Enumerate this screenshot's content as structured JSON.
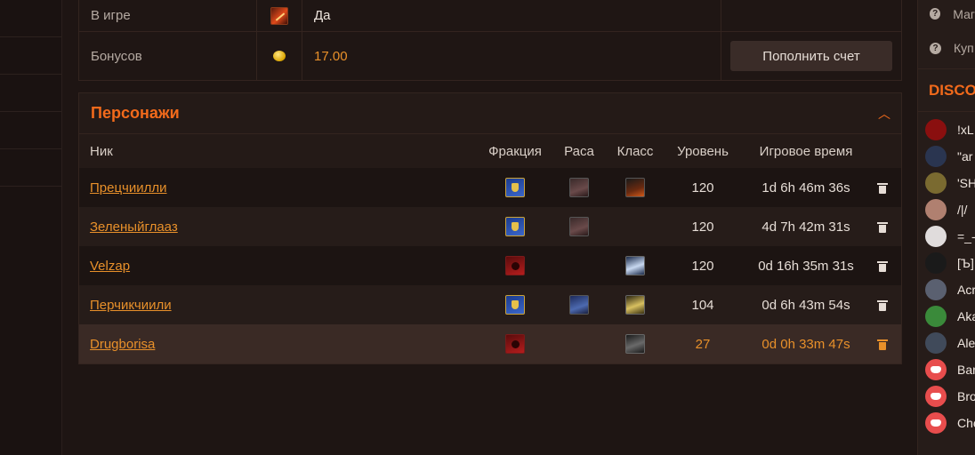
{
  "account_info": {
    "rows": [
      {
        "label": "В игре",
        "icon": "game-icon",
        "value": "Да"
      },
      {
        "label": "Бонусов",
        "icon": "coin-icon",
        "value": "17.00",
        "action": "Пополнить счет"
      }
    ]
  },
  "characters": {
    "title": "Персонажи",
    "columns": {
      "nick": "Ник",
      "faction": "Фракция",
      "race": "Раса",
      "class": "Класс",
      "level": "Уровень",
      "time": "Игровое время"
    },
    "rows": [
      {
        "nick": "Прецчиилли",
        "faction": "alliance",
        "race": "race-icon",
        "class": "class-rogue",
        "level": "120",
        "time": "1d 6h 46m 36s"
      },
      {
        "nick": "Зеленыйглааз",
        "faction": "alliance",
        "race": "race-icon",
        "class": "",
        "level": "120",
        "time": "4d 7h 42m 31s"
      },
      {
        "nick": "Velzap",
        "faction": "horde",
        "race": "",
        "class": "class-warrior",
        "level": "120",
        "time": "0d 16h 35m 31s"
      },
      {
        "nick": "Перчикчиили",
        "faction": "alliance",
        "race": "race-blue",
        "class": "class-paladin",
        "level": "104",
        "time": "0d 6h 43m 54s"
      },
      {
        "nick": "Drugborisa",
        "faction": "horde",
        "race": "",
        "class": "class-dk",
        "level": "27",
        "time": "0d 0h 33m 47s"
      }
    ]
  },
  "right_sidebar": {
    "links": [
      "Маг",
      "Куп"
    ],
    "discord_title": "DISCO",
    "members": [
      {
        "name": "!xL",
        "avatar": "#8a0f0f"
      },
      {
        "name": "\"ar",
        "avatar": "#2a3550"
      },
      {
        "name": "'SH",
        "avatar": "#7a6a30"
      },
      {
        "name": "/|/",
        "avatar": "#b08070"
      },
      {
        "name": "=_-",
        "avatar": "#e0dcdc"
      },
      {
        "name": "[Ъ]",
        "avatar": "#1a1a1a"
      },
      {
        "name": "Acr",
        "avatar": "#5a6070"
      },
      {
        "name": "Aka",
        "avatar": "#3a8a3a"
      },
      {
        "name": "Ale",
        "avatar": "#404a5a"
      },
      {
        "name": "Bar",
        "avatar": "discord"
      },
      {
        "name": "Bro",
        "avatar": "discord"
      },
      {
        "name": "Che",
        "avatar": "discord"
      }
    ]
  },
  "colors": {
    "accent": "#f26a1b",
    "link": "#e8902a",
    "background": "#1e1513"
  }
}
